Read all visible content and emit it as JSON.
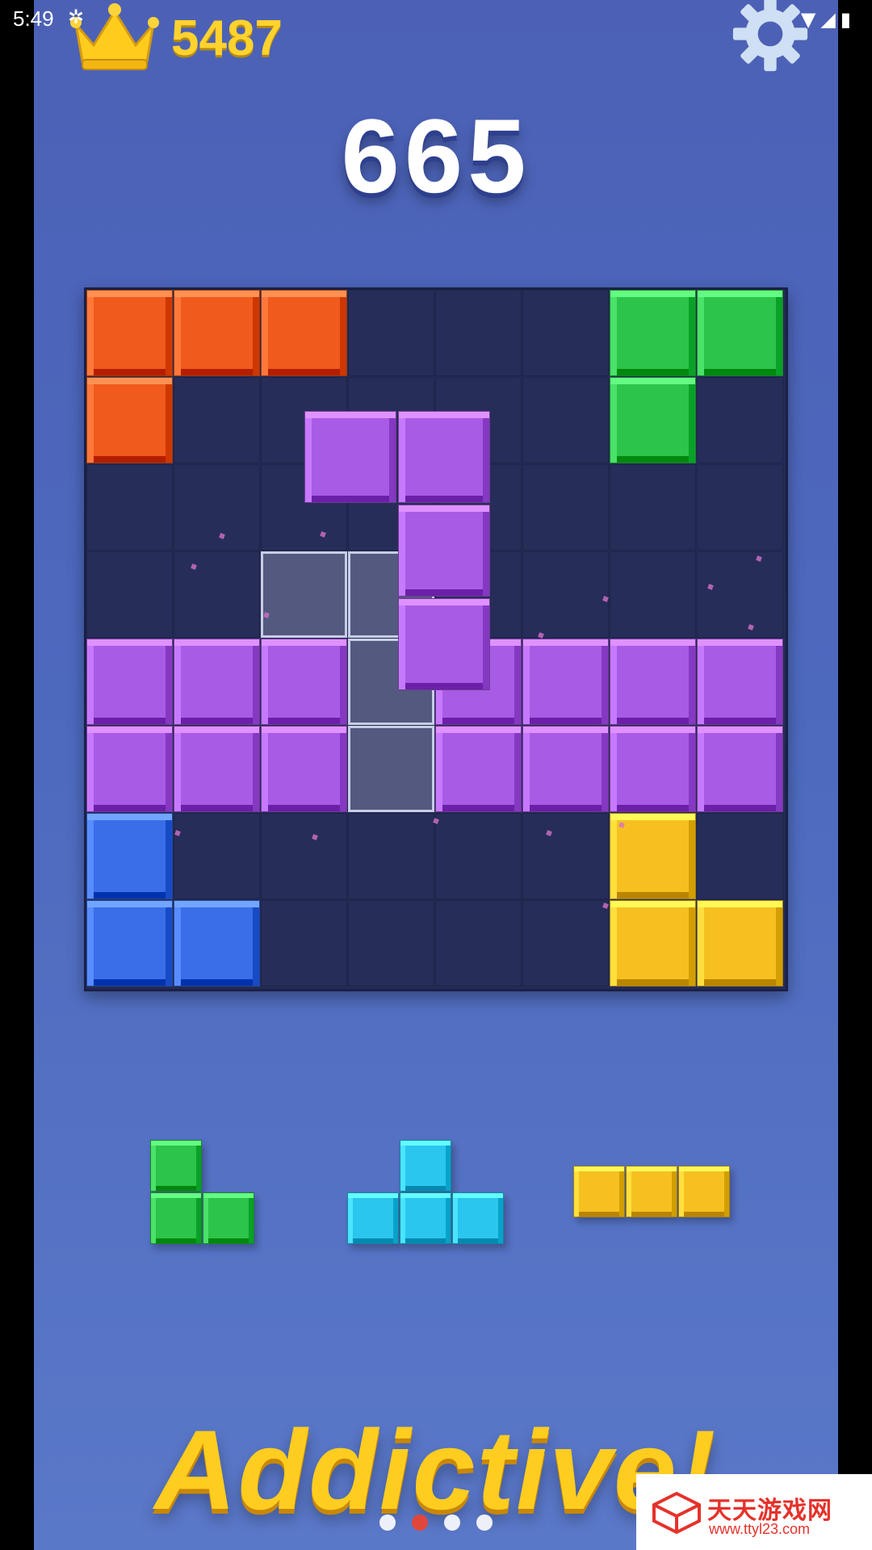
{
  "status_bar": {
    "time": "5:49",
    "debug_icon": "bug-icon",
    "icons": [
      "wifi-icon",
      "signal-icon",
      "battery-icon"
    ]
  },
  "header": {
    "best_score": "5487",
    "best_icon": "crown-icon",
    "settings_icon": "gear-icon"
  },
  "score": "665",
  "board": {
    "cols": 8,
    "rows": 8,
    "colors": {
      "O": "#f05a1c",
      "G": "#2cc44a",
      "P": "#a85be4",
      "B": "#3a6ee8",
      "Y": "#f6c120"
    },
    "grid": [
      "OOO...GG",
      "O.....G.",
      "........",
      "........",
      "PPP.PPPP",
      "PPP.PPPP",
      "B.....Y.",
      "BB....YYY"
    ]
  },
  "tray": [
    {
      "name": "green-l-piece",
      "color": "#2cc44a",
      "cells": [
        [
          0,
          0
        ],
        [
          0,
          1
        ],
        [
          1,
          1
        ]
      ]
    },
    {
      "name": "cyan-t-piece",
      "color": "#2bc6ee",
      "cells": [
        [
          1,
          0
        ],
        [
          0,
          1
        ],
        [
          1,
          1
        ],
        [
          2,
          1
        ]
      ]
    },
    {
      "name": "yellow-line-piece",
      "color": "#f6c120",
      "cells": [
        [
          0,
          0
        ],
        [
          1,
          0
        ],
        [
          2,
          0
        ]
      ]
    }
  ],
  "tagline": "Addictive!",
  "pager": {
    "count": 4,
    "active": 1
  },
  "watermark": {
    "title": "天天游戏网",
    "url": "www.ttyl23.com"
  }
}
